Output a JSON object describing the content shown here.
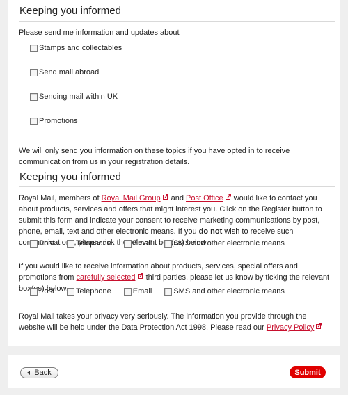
{
  "section1": {
    "title": "Keeping you informed",
    "intro": "Please send me information and updates about",
    "topics": [
      "Stamps and collectables",
      "Send mail abroad",
      "Sending mail within UK",
      "Promotions"
    ],
    "note": "We will only send you information on these topics if you have opted in to receive communication from us in your registration details."
  },
  "section2": {
    "title": "Keeping you informed",
    "p1_a": "Royal Mail, members of ",
    "p1_link1": "Royal Mail Group",
    "p1_b": " and ",
    "p1_link2": "Post Office",
    "p1_c": " would like to contact you about products, services and offers that might interest you. Click on the Register button to submit this form and indicate your consent to receive marketing communications by post, phone, email, text and other electronic means. If you ",
    "p1_bold": "do not",
    "p1_d": " wish to receive such communications, please tick the relevant box(es) below.",
    "channels1": [
      "Post",
      "Telephone",
      "Email",
      "SMS and other electronic means"
    ],
    "p2_a": "If you would like to receive information about products, services, special offers and promotions from ",
    "p2_link": "carefully selected",
    "p2_b": " third parties, please let us know by ticking the relevant box(es) below.",
    "channels2": [
      "Post",
      "Telephone",
      "Email",
      "SMS and other electronic means"
    ],
    "p3_a": "Royal Mail takes your privacy very seriously. The information you provide through the website will be held under the Data Protection Act 1998. Please read our ",
    "p3_link": "Privacy Policy"
  },
  "actions": {
    "back_label": "Back",
    "submit_label": "Submit"
  },
  "colors": {
    "accent": "#c8102e",
    "submit_bg": "#e00000",
    "page_bg": "#efefef"
  },
  "icons": {
    "external_link": "external-link-icon"
  }
}
